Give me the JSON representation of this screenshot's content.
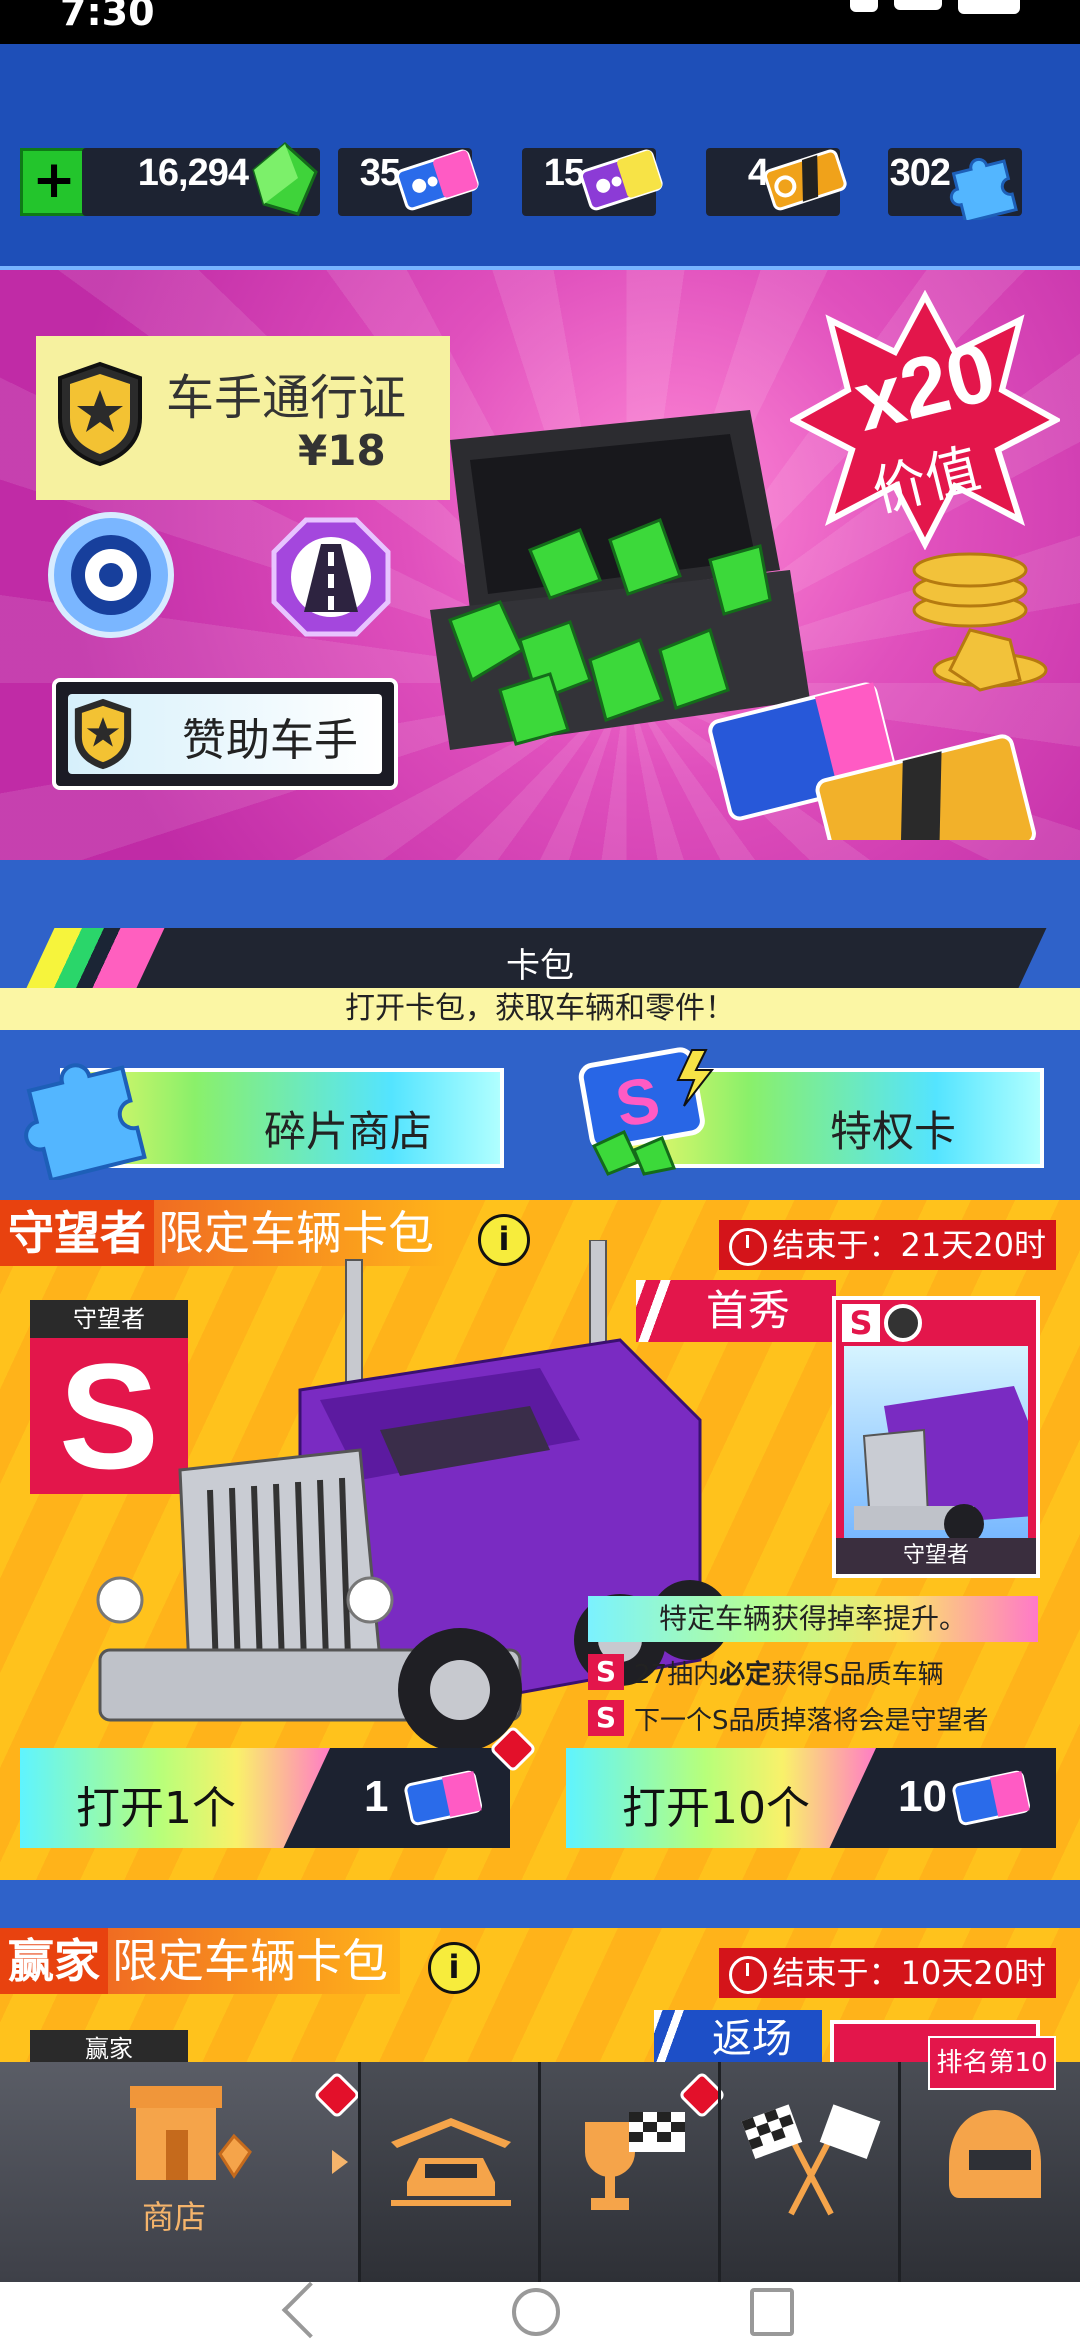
{
  "status_bar": {
    "time": "7:30"
  },
  "currency": [
    {
      "value": "16,294",
      "icon": "gem-icon"
    },
    {
      "value": "35",
      "icon": "blue-ticket-icon"
    },
    {
      "value": "15",
      "icon": "purple-ticket-icon"
    },
    {
      "value": "4",
      "icon": "turbo-ticket-icon"
    },
    {
      "value": "302",
      "icon": "puzzle-piece-icon"
    }
  ],
  "driver_pass": {
    "title": "车手通行证",
    "price": "¥18",
    "value_badge_top": "x20",
    "value_badge_bottom": "价值",
    "sponsor_button": "赞助车手"
  },
  "card_packs": {
    "header": "卡包",
    "subtitle": "打开卡包，获取车辆和零件！",
    "fragment_shop": "碎片商店",
    "privilege_card": "特权卡"
  },
  "pack1": {
    "name": "守望者",
    "title_rest": "限定车辆卡包",
    "timer": "结束于：21天20时",
    "rarity_header": "守望者",
    "rarity_letter": "S",
    "debut": "首秀",
    "mini_card_tag": "S",
    "mini_card_name": "守望者",
    "rate_text": "特定车辆获得掉率提升。",
    "note1_pre": "27抽内",
    "note1_bold": "必定",
    "note1_post": "获得S品质车辆",
    "note2": "下一个S品质掉落将会是守望者",
    "open1_label": "打开1个",
    "open1_cost": "1",
    "open10_label": "打开10个",
    "open10_cost": "10"
  },
  "pack2": {
    "name": "赢家",
    "title_rest": "限定车辆卡包",
    "timer": "结束于：10天20时",
    "rarity_header": "赢家",
    "return_tag": "返场",
    "rank_tag": "排名第10"
  },
  "bottom_nav": {
    "shop_label": "商店"
  },
  "colors": {
    "accent_red": "#e3164b",
    "background_blue": "#2f62c9",
    "pass_pink": "#e050bd",
    "pack_orange": "#ffb31a"
  }
}
